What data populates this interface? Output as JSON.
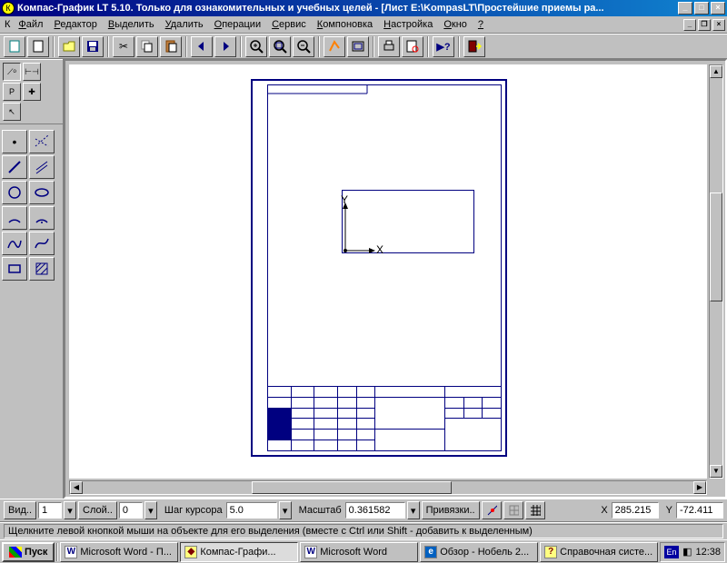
{
  "window": {
    "title": "Компас-График LT 5.10. Только для ознакомительных и учебных целей - [Лист E:\\KompasLT\\Простейшие приемы ра..."
  },
  "menus": [
    "Файл",
    "Редактор",
    "Выделить",
    "Удалить",
    "Операции",
    "Сервис",
    "Компоновка",
    "Настройка",
    "Окно",
    "?"
  ],
  "propbar": {
    "vid_label": "Вид..",
    "vid_value": "1",
    "layer_label": "Слой..",
    "layer_value": "0",
    "step_label": "Шаг курсора",
    "step_value": "5.0",
    "scale_label": "Масштаб",
    "scale_value": "0.361582",
    "snap_label": "Привязки..",
    "x_label": "X",
    "x_value": "285.215",
    "y_label": "Y",
    "y_value": "-72.411"
  },
  "status": {
    "hint": "Щелкните левой кнопкой мыши на объекте для его выделения (вместе с Ctrl или Shift - добавить к выделенным)"
  },
  "drawing": {
    "x_axis": "X",
    "y_axis": "Y"
  },
  "taskbar": {
    "start": "Пуск",
    "tasks": [
      {
        "label": "Microsoft Word - П...",
        "icon": "W",
        "active": false
      },
      {
        "label": "Компас-Графи...",
        "icon": "◆",
        "active": true
      },
      {
        "label": "Microsoft Word",
        "icon": "W",
        "active": false
      },
      {
        "label": "Обзор - Нобель 2...",
        "icon": "e",
        "active": false
      },
      {
        "label": "Справочная систе...",
        "icon": "?",
        "active": false
      }
    ],
    "lang": "En",
    "clock": "12:38"
  }
}
